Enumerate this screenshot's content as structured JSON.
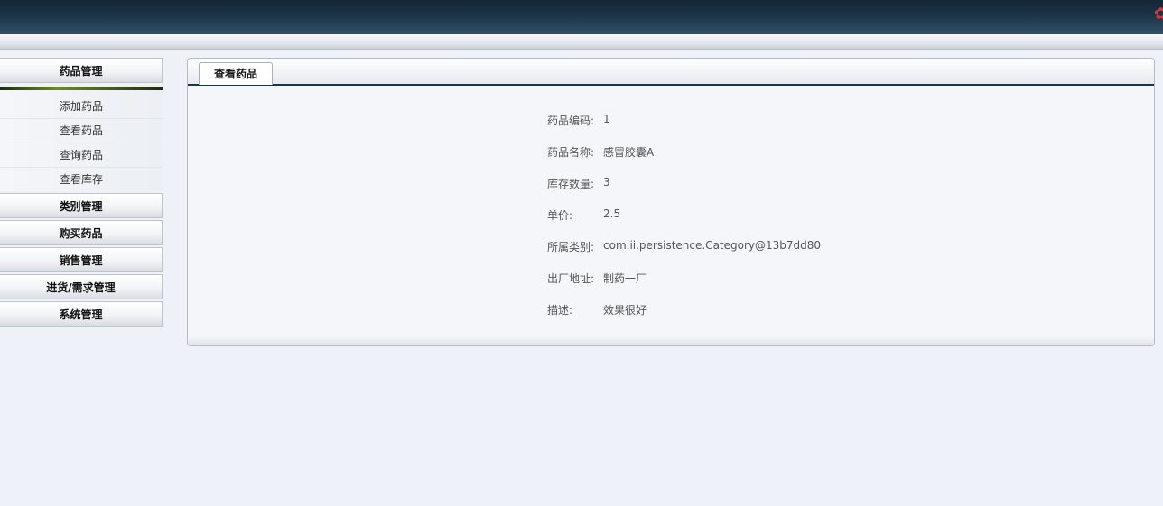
{
  "sidebar": {
    "groups": [
      {
        "label": "药品管理",
        "items": [
          "添加药品",
          "查看药品",
          "查询药品",
          "查看库存"
        ]
      },
      {
        "label": "类别管理"
      },
      {
        "label": "购买药品"
      },
      {
        "label": "销售管理"
      },
      {
        "label": "进货/需求管理"
      },
      {
        "label": "系统管理"
      }
    ]
  },
  "tab": {
    "label": "查看药品"
  },
  "details": [
    {
      "label": "药品编码:",
      "value": "1"
    },
    {
      "label": "药品名称:",
      "value": "感冒胶囊A"
    },
    {
      "label": "库存数量:",
      "value": "3"
    },
    {
      "label": "单价:",
      "value": "2.5"
    },
    {
      "label": "所属类别:",
      "value": "com.ii.persistence.Category@13b7dd80"
    },
    {
      "label": "出厂地址:",
      "value": "制药一厂"
    },
    {
      "label": "描述:",
      "value": "效果很好"
    }
  ]
}
